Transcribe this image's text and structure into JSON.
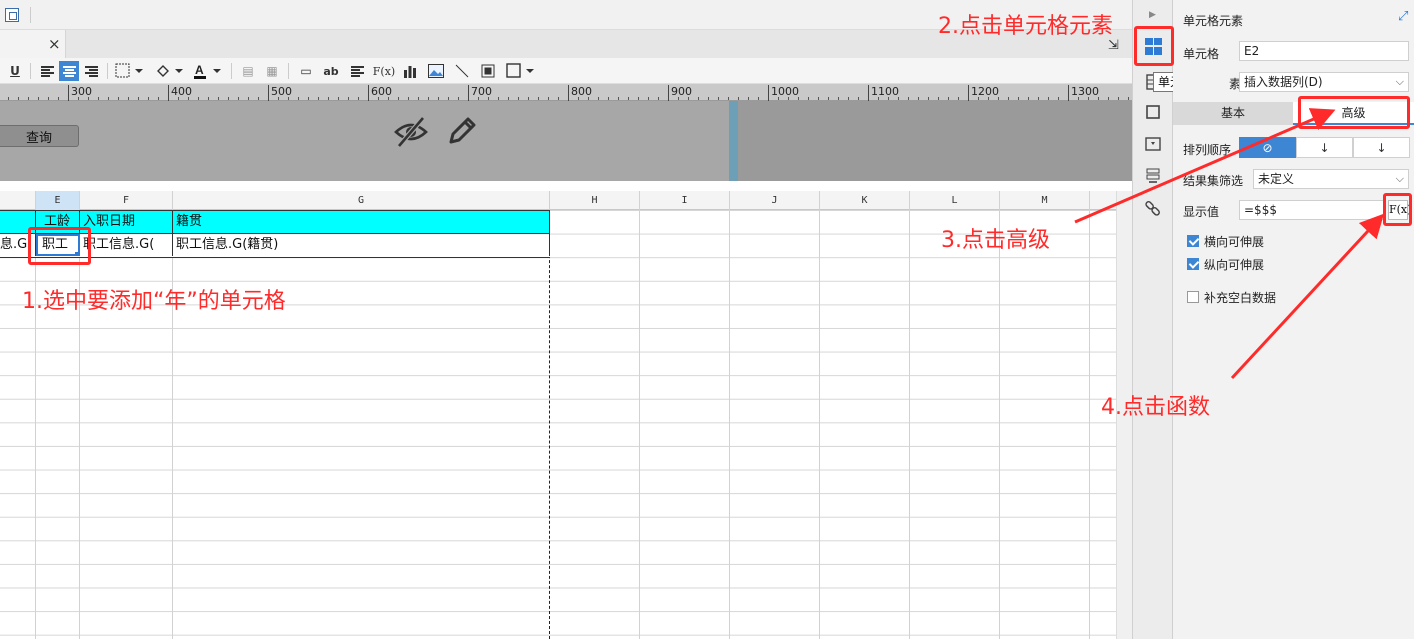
{
  "toolbar": {
    "close_glyph": "×",
    "underline": "U",
    "text_ab": "ab",
    "fx": "F(x)"
  },
  "ruler": {
    "labels": [
      "300",
      "400",
      "500",
      "600",
      "700",
      "800",
      "900",
      "1000",
      "1100",
      "1200",
      "1300"
    ]
  },
  "params": {
    "query_button": "查询"
  },
  "grid": {
    "columns": [
      {
        "name": "E",
        "selected": true
      },
      {
        "name": "F"
      },
      {
        "name": "G"
      },
      {
        "name": "H"
      },
      {
        "name": "I"
      },
      {
        "name": "J"
      },
      {
        "name": "K"
      },
      {
        "name": "L"
      },
      {
        "name": "M"
      }
    ],
    "header_row": [
      "工龄",
      "入职日期",
      "籍贯"
    ],
    "data_row": [
      "息.G",
      "职工",
      "职工信息.G(",
      "职工信息.G(籍贯)"
    ]
  },
  "tooltip": "单元格元素",
  "props": {
    "title": "单元格元素",
    "cell_label": "单元格",
    "cell_value": "E2",
    "element_label_suffix": "素",
    "element_value": "插入数据列(D)",
    "tab_basic": "基本",
    "tab_advanced": "高级",
    "sort_label": "排列顺序",
    "sort_options": [
      "⊘",
      "↓",
      "↓"
    ],
    "filter_label": "结果集筛选",
    "filter_value": "未定义",
    "display_label": "显示值",
    "display_value": "=$$$",
    "fx_button": "F(x)",
    "check_h": "横向可伸展",
    "check_v": "纵向可伸展",
    "check_fill": "补充空白数据"
  },
  "annotations": {
    "step1": "1.选中要添加“年”的单元格",
    "step2": "2.点击单元格元素",
    "step3": "3.点击高级",
    "step4": "4.点击函数"
  },
  "colors": {
    "accent": "#3d86d3",
    "header_fill": "#00ffff",
    "annotation": "#ff2a2a"
  }
}
